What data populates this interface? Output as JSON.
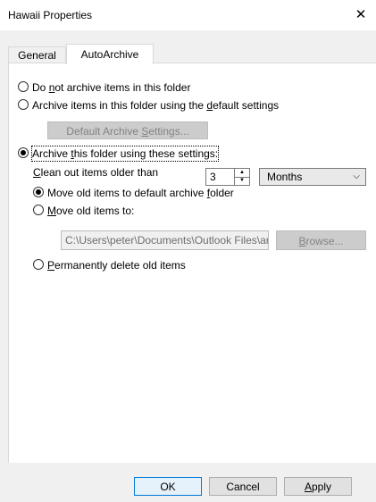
{
  "window": {
    "title": "Hawaii Properties",
    "close_glyph": "✕"
  },
  "tabs": [
    {
      "label": "General"
    },
    {
      "label": "AutoArchive"
    }
  ],
  "options": {
    "do_not_archive": {
      "pre": "Do ",
      "u": "n",
      "post": "ot archive items in this folder"
    },
    "archive_default": {
      "pre": "Archive items in this folder using the ",
      "u": "d",
      "post": "efault settings"
    },
    "default_settings_button": {
      "pre": "Default Archive ",
      "u": "S",
      "post": "ettings..."
    },
    "archive_these": {
      "pre": "Archive ",
      "u": "t",
      "post": "his folder using these settings:"
    }
  },
  "clean_out": {
    "pre": "",
    "u": "C",
    "post": "lean out items older than",
    "value": "3",
    "unit": "Months"
  },
  "move_default": {
    "pre": "Move old items to default archive ",
    "u": "f",
    "post": "older"
  },
  "move_to": {
    "pre": "",
    "u": "M",
    "post": "ove old items to:",
    "path": "C:\\Users\\peter\\Documents\\Outlook Files\\archive.pst"
  },
  "browse_button": {
    "pre": "",
    "u": "B",
    "post": "rowse..."
  },
  "permanently_delete": {
    "pre": "",
    "u": "P",
    "post": "ermanently delete old items"
  },
  "footer": {
    "ok": "OK",
    "cancel": "Cancel",
    "apply": {
      "pre": "",
      "u": "A",
      "post": "pply"
    }
  },
  "icons": {
    "spin_up": "▲",
    "spin_down": "▼",
    "dropdown": "chevron-down-icon"
  }
}
